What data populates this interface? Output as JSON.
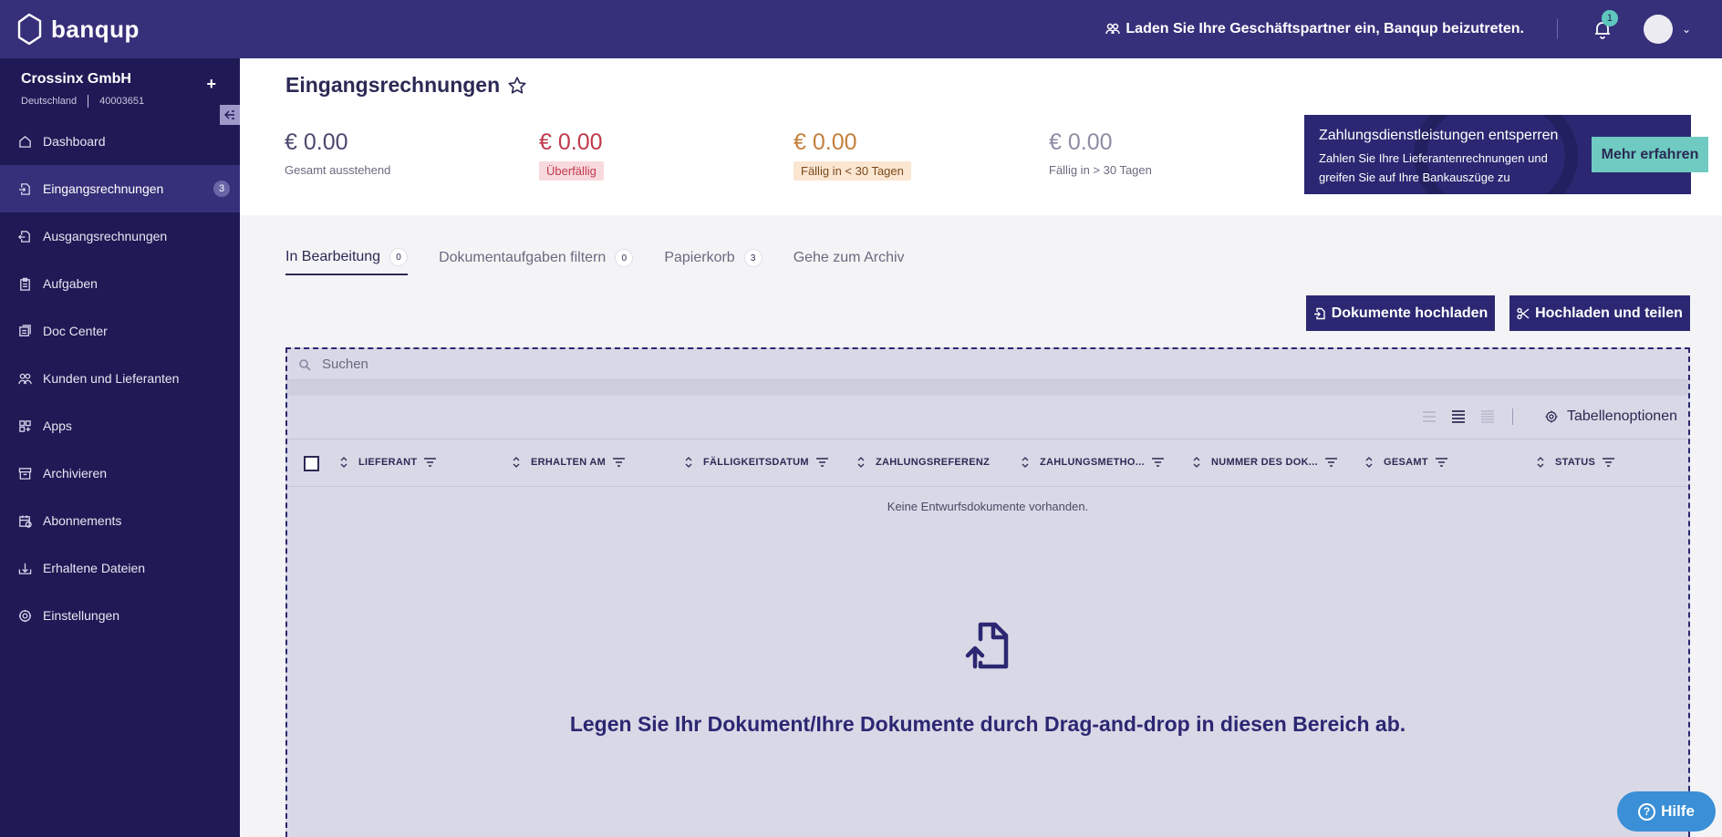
{
  "app": {
    "logo_text": "banqup"
  },
  "topbar": {
    "invite_text": "Laden Sie Ihre Geschäftspartner ein, Banqup beizutreten.",
    "notification_count": "1"
  },
  "company": {
    "name": "Crossinx GmbH",
    "country": "Deutschland",
    "id": "40003651",
    "add_label": "+"
  },
  "sidebar": {
    "items": [
      {
        "label": "Dashboard",
        "icon": "dashboard-icon"
      },
      {
        "label": "Eingangsrechnungen",
        "icon": "incoming-invoice-icon",
        "badge": "3"
      },
      {
        "label": "Ausgangsrechnungen",
        "icon": "outgoing-invoice-icon"
      },
      {
        "label": "Aufgaben",
        "icon": "clipboard-icon"
      },
      {
        "label": "Doc Center",
        "icon": "doc-center-icon"
      },
      {
        "label": "Kunden und Lieferanten",
        "icon": "contacts-icon"
      },
      {
        "label": "Apps",
        "icon": "apps-icon"
      },
      {
        "label": "Archivieren",
        "icon": "archive-icon"
      },
      {
        "label": "Abonnements",
        "icon": "subscription-icon"
      },
      {
        "label": "Erhaltene Dateien",
        "icon": "inbox-icon"
      },
      {
        "label": "Einstellungen",
        "icon": "settings-icon"
      }
    ]
  },
  "page": {
    "title": "Eingangsrechnungen"
  },
  "stats": [
    {
      "amount": "€ 0.00",
      "label": "Gesamt ausstehend",
      "color": "#4a4870"
    },
    {
      "amount": "€ 0.00",
      "label": "Überfällig",
      "color": "#c0394b"
    },
    {
      "amount": "€ 0.00",
      "label": "Fällig in < 30 Tagen",
      "color": "#c47f3a"
    },
    {
      "amount": "€ 0.00",
      "label": "Fällig in > 30 Tagen",
      "color": "#8e8da5"
    }
  ],
  "promo": {
    "title": "Zahlungsdienstleistungen entsperren",
    "text": "Zahlen Sie Ihre Lieferantenrechnungen und greifen Sie auf Ihre Bankauszüge zu",
    "button": "Mehr erfahren"
  },
  "tabs": [
    {
      "label": "In Bearbeitung",
      "count": "0"
    },
    {
      "label": "Dokumentaufgaben filtern",
      "count": "0"
    },
    {
      "label": "Papierkorb",
      "count": "3"
    },
    {
      "label": "Gehe zum Archiv"
    }
  ],
  "actions": {
    "upload": "Dokumente hochladen",
    "upload_split": "Hochladen und teilen"
  },
  "search": {
    "placeholder": "Suchen"
  },
  "table": {
    "options_label": "Tabellenoptionen",
    "columns": [
      "LIEFERANT",
      "ERHALTEN AM",
      "FÄLLIGKEITSDATUM",
      "ZAHLUNGSREFERENZ",
      "ZAHLUNGSMETHO...",
      "NUMMER DES DOK...",
      "GESAMT",
      "STATUS"
    ],
    "empty_text": "Keine Entwurfsdokumente vorhanden."
  },
  "dropzone": {
    "text": "Legen Sie Ihr Dokument/Ihre Dokumente durch Drag-and-drop in diesen Bereich ab."
  },
  "help": {
    "label": "Hilfe"
  }
}
